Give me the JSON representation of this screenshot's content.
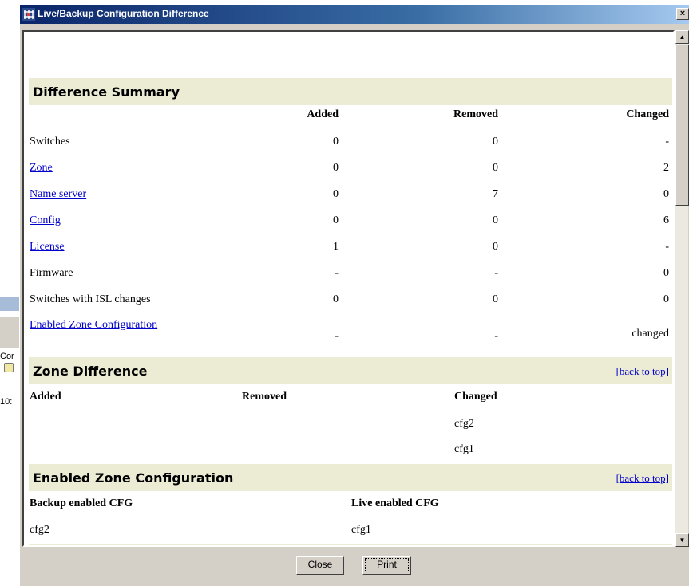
{
  "background_window": {
    "label_fragment": "Cor",
    "time_fragment": "10:"
  },
  "dialog": {
    "title": "Live/Backup Configuration Difference",
    "close_glyph": "×"
  },
  "difference_summary": {
    "heading": "Difference Summary",
    "columns": [
      "Added",
      "Removed",
      "Changed"
    ],
    "rows": [
      {
        "label": "Switches",
        "link": false,
        "added": "0",
        "removed": "0",
        "changed": "-"
      },
      {
        "label": "Zone",
        "link": true,
        "added": "0",
        "removed": "0",
        "changed": "2"
      },
      {
        "label": "Name server",
        "link": true,
        "added": "0",
        "removed": "7",
        "changed": "0"
      },
      {
        "label": "Config",
        "link": true,
        "added": "0",
        "removed": "0",
        "changed": "6"
      },
      {
        "label": "License",
        "link": true,
        "added": "1",
        "removed": "0",
        "changed": "-"
      },
      {
        "label": "Firmware",
        "link": false,
        "added": "-",
        "removed": "-",
        "changed": "0"
      },
      {
        "label": "Switches with ISL changes",
        "link": false,
        "added": "0",
        "removed": "0",
        "changed": "0"
      },
      {
        "label": "Enabled Zone Configuration",
        "link": true,
        "added": "-",
        "removed": "-",
        "changed": "changed"
      }
    ]
  },
  "zone_difference": {
    "heading": "Zone Difference",
    "back_link": "[back to top]",
    "columns": [
      "Added",
      "Removed",
      "Changed"
    ],
    "changed_items": [
      "cfg2",
      "cfg1"
    ]
  },
  "enabled_zone_configuration": {
    "heading": "Enabled Zone Configuration",
    "back_link": "[back to top]",
    "backup_label": "Backup enabled CFG",
    "live_label": "Live enabled CFG",
    "backup_value": "cfg2",
    "live_value": "cfg1"
  },
  "buttons": {
    "close": "Close",
    "print": "Print"
  },
  "colors": {
    "section_header_bg": "#ecebd3",
    "link": "#0000cc",
    "titlebar_start": "#0a246a",
    "dialog_face": "#d4d0c8"
  }
}
